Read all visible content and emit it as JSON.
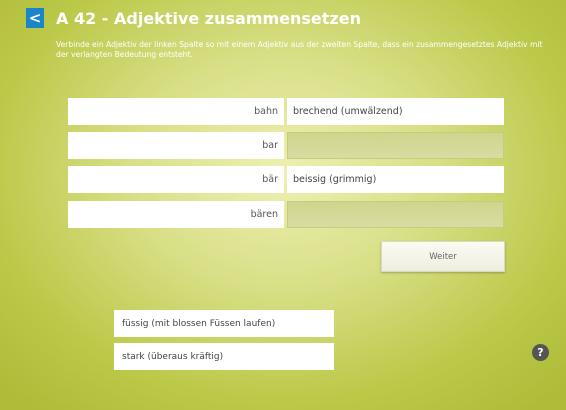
{
  "header": {
    "back_icon": "chevron-left-icon",
    "back_glyph": "<",
    "title": "A 42 - Adjektive zusammensetzen"
  },
  "instructions": "Verbinde ein Adjektiv der linken Spalte so mit einem Adjektiv aus der zweiten Spalte, dass ein zusammengesetztes Adjektiv mit der verlangten Bedeutung entsteht.",
  "pairs": [
    {
      "left": "bahn",
      "right": "brechend (umwälzend)"
    },
    {
      "left": "bar",
      "right": ""
    },
    {
      "left": "bär",
      "right": "beissig (grimmig)"
    },
    {
      "left": "bären",
      "right": ""
    }
  ],
  "next_button": "Weiter",
  "answer_options": [
    "füssig (mit blossen Füssen laufen)",
    "stark (überaus kräftig)"
  ],
  "help_icon": {
    "name": "help-icon",
    "glyph": "?"
  },
  "colors": {
    "accent": "#1a86c8",
    "background": "#d8df86"
  }
}
